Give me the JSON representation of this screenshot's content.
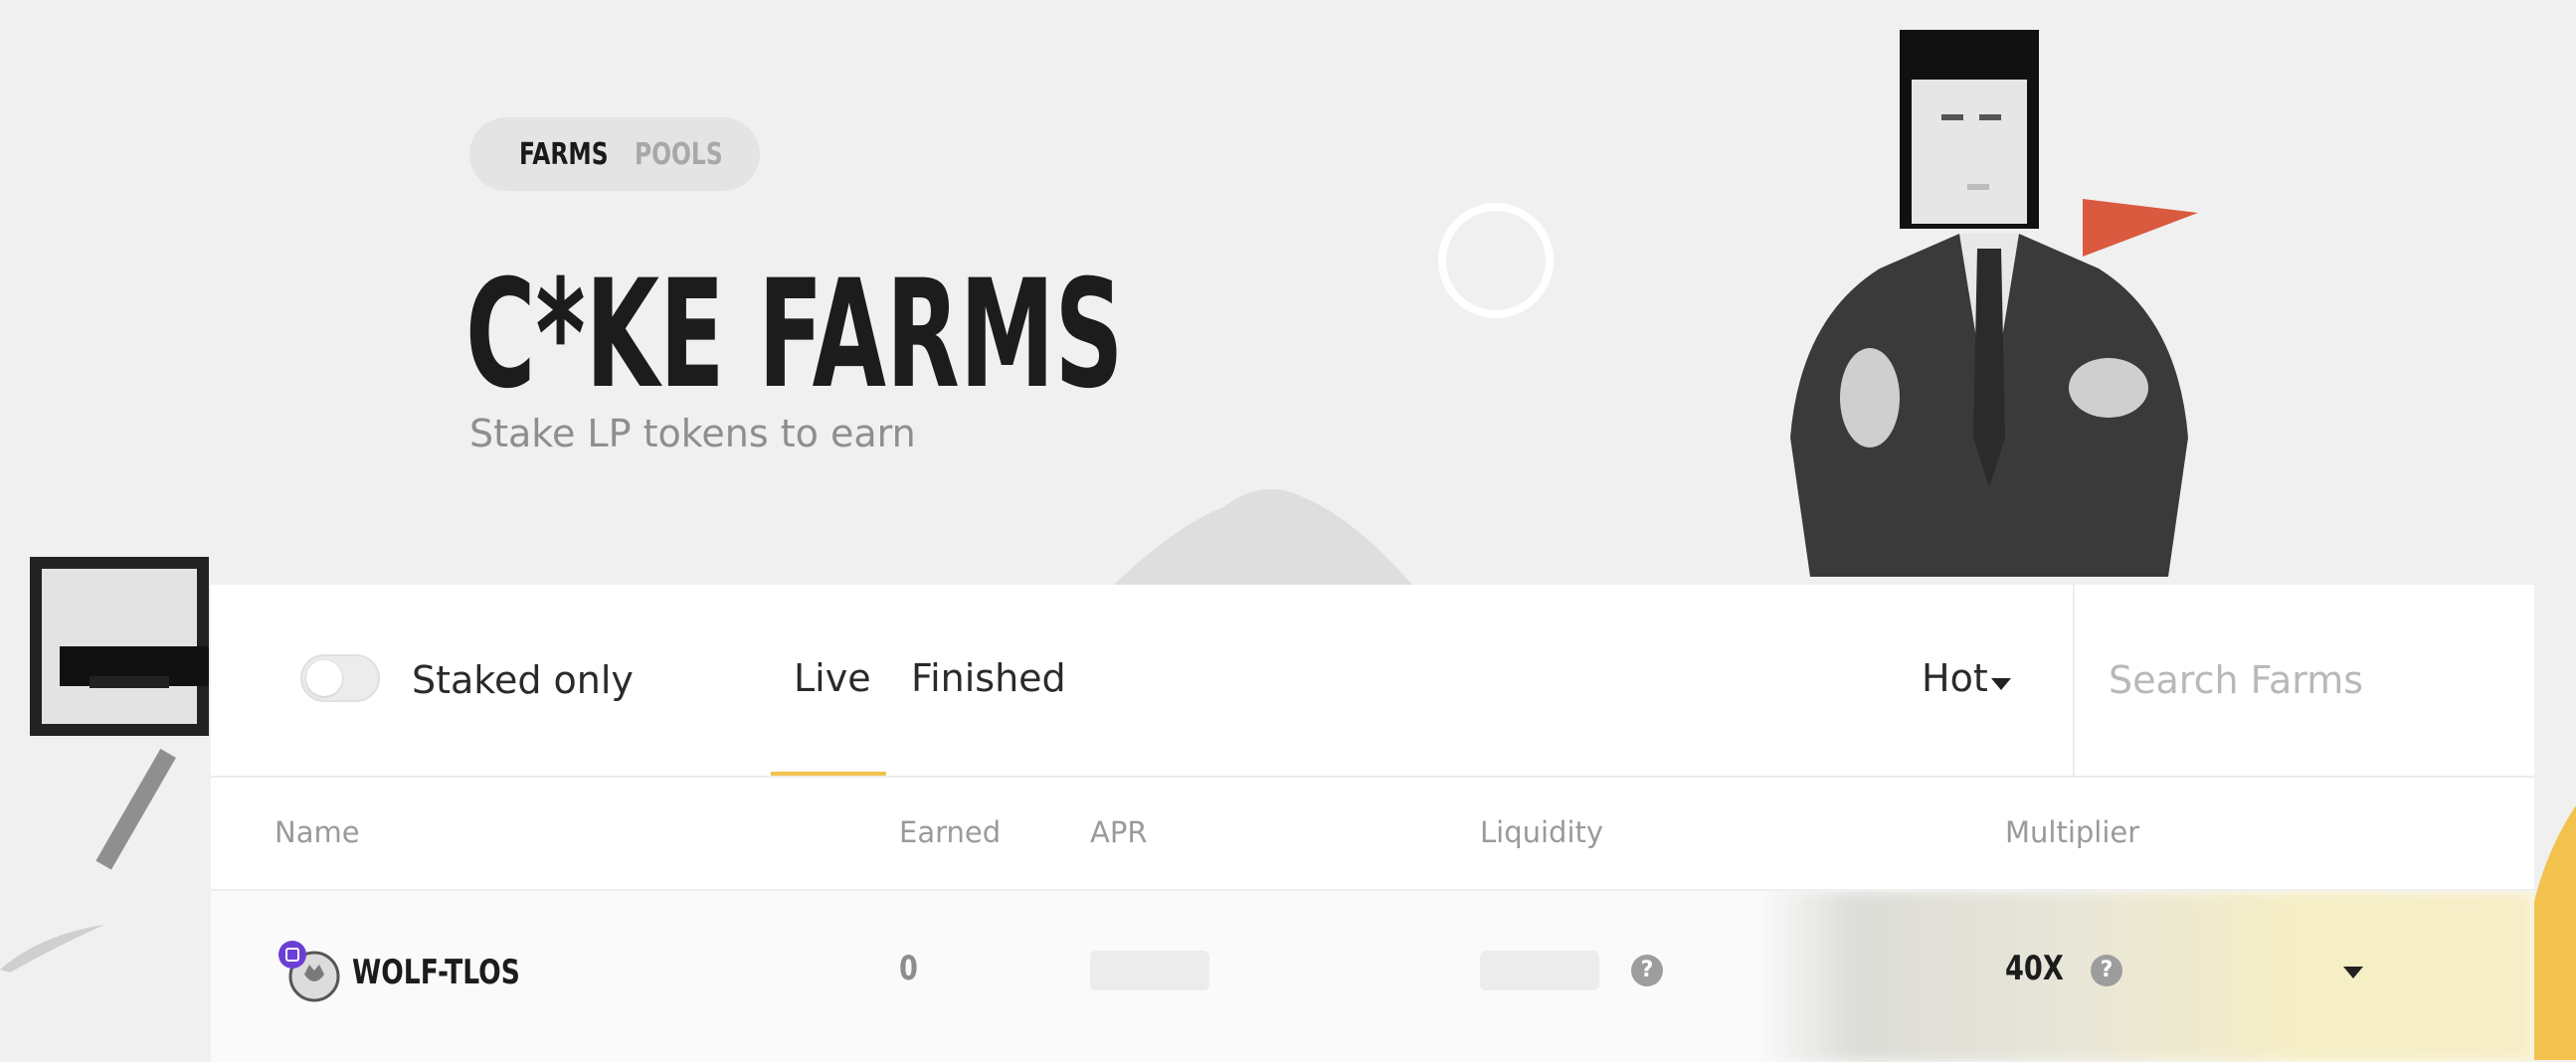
{
  "header": {
    "segment": {
      "farms_label": "FARMS",
      "pools_label": "POOLS",
      "active": "FARMS"
    },
    "title": "C*KE FARMS",
    "subtitle": "Stake LP tokens to earn"
  },
  "colors": {
    "accent": "#f2c14e",
    "flag": "#d95a3f",
    "text": "#1c1c1c",
    "muted": "#9a9a9a"
  },
  "toolbar": {
    "staked_only_label": "Staked only",
    "staked_only_on": false,
    "tabs": [
      {
        "label": "Live",
        "active": true
      },
      {
        "label": "Finished",
        "active": false
      }
    ],
    "sort_label": "Hot",
    "search": {
      "placeholder": "Search Farms",
      "value": ""
    }
  },
  "table": {
    "headers": {
      "name": "Name",
      "earned": "Earned",
      "apr": "APR",
      "liquidity": "Liquidity",
      "multiplier": "Multiplier"
    },
    "rows": [
      {
        "name": "WOLF-TLOS",
        "earned": "0",
        "apr_loading": true,
        "liquidity_loading": true,
        "multiplier": "40X",
        "icon": "wolf-tlos-token-icon"
      }
    ]
  },
  "icons": {
    "liquidity_help": "question-icon",
    "multiplier_help": "question-icon",
    "expand": "chevron-down-icon",
    "sort": "caret-down-icon"
  }
}
